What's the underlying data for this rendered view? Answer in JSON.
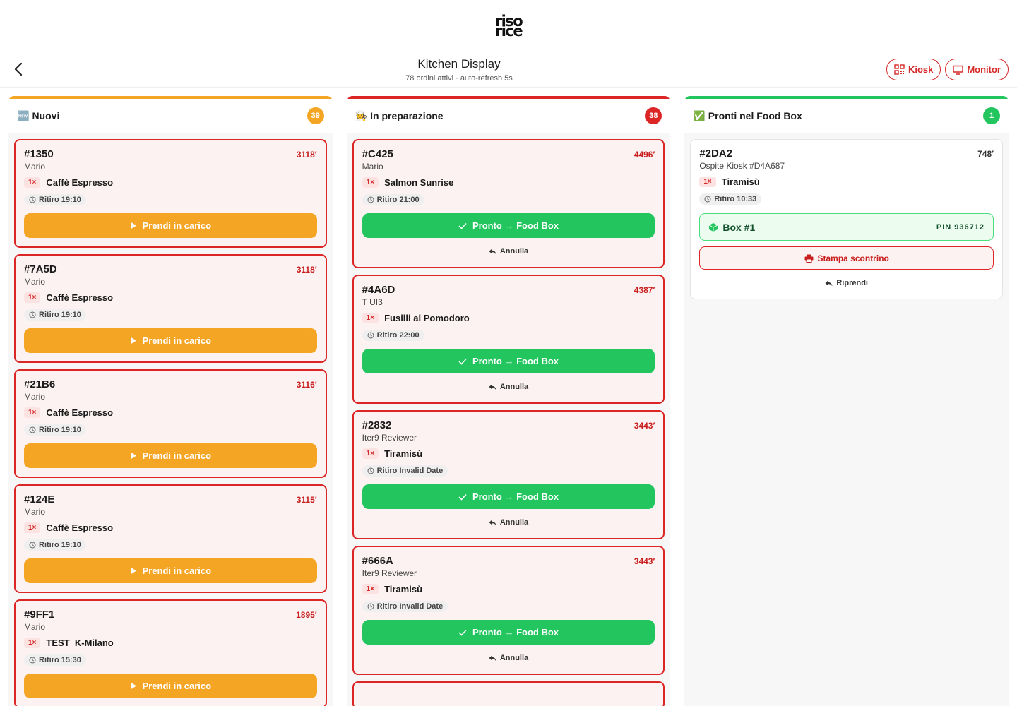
{
  "brand": {
    "line1": "riso",
    "line2": "rice"
  },
  "header": {
    "title": "Kitchen Display",
    "subtitle": "78 ordini attivi · auto-refresh 5s",
    "kiosk_label": "Kiosk",
    "monitor_label": "Monitor"
  },
  "colors": {
    "new": "#f5a524",
    "prep": "#dc2626",
    "ready": "#22c55e"
  },
  "columns": {
    "new": {
      "emoji": "🆕",
      "title": "Nuovi",
      "count": "39",
      "action_label": "Prendi in carico",
      "orders": [
        {
          "id": "#1350",
          "age": "3118′",
          "customer": "Mario",
          "qty": "1×",
          "item": "Caffè Espresso",
          "pickup": "Ritiro 19:10"
        },
        {
          "id": "#7A5D",
          "age": "3118′",
          "customer": "Mario",
          "qty": "1×",
          "item": "Caffè Espresso",
          "pickup": "Ritiro 19:10"
        },
        {
          "id": "#21B6",
          "age": "3116′",
          "customer": "Mario",
          "qty": "1×",
          "item": "Caffè Espresso",
          "pickup": "Ritiro 19:10"
        },
        {
          "id": "#124E",
          "age": "3115′",
          "customer": "Mario",
          "qty": "1×",
          "item": "Caffè Espresso",
          "pickup": "Ritiro 19:10"
        },
        {
          "id": "#9FF1",
          "age": "1895′",
          "customer": "Mario",
          "qty": "1×",
          "item": "TEST_K-Milano",
          "pickup": "Ritiro 15:30"
        }
      ]
    },
    "prep": {
      "emoji": "🧑‍🍳",
      "title": "In preparazione",
      "count": "38",
      "action_label": "Pronto → Food Box",
      "cancel_label": "Annulla",
      "orders": [
        {
          "id": "#C425",
          "age": "4496′",
          "customer": "Mario",
          "qty": "1×",
          "item": "Salmon Sunrise",
          "pickup": "Ritiro 21:00"
        },
        {
          "id": "#4A6D",
          "age": "4387′",
          "customer": "T UI3",
          "qty": "1×",
          "item": "Fusilli al Pomodoro",
          "pickup": "Ritiro 22:00"
        },
        {
          "id": "#2832",
          "age": "3443′",
          "customer": "Iter9 Reviewer",
          "qty": "1×",
          "item": "Tiramisù",
          "pickup": "Ritiro Invalid Date"
        },
        {
          "id": "#666A",
          "age": "3443′",
          "customer": "Iter9 Reviewer",
          "qty": "1×",
          "item": "Tiramisù",
          "pickup": "Ritiro Invalid Date"
        }
      ]
    },
    "ready": {
      "emoji": "✅",
      "title": "Pronti nel Food Box",
      "count": "1",
      "orders": [
        {
          "id": "#2DA2",
          "age": "748′",
          "customer": "Ospite Kiosk #D4A687",
          "qty": "1×",
          "item": "Tiramisù",
          "pickup": "Ritiro 10:33",
          "box": "Box #1",
          "pin": "PIN 936712",
          "print_label": "Stampa scontrino",
          "resume_label": "Riprendi"
        }
      ]
    }
  }
}
